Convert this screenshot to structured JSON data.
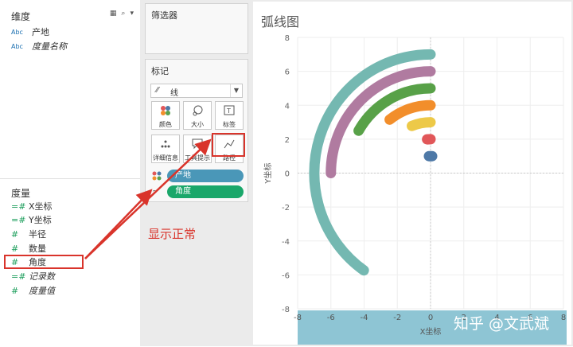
{
  "data_pane": {
    "dimensions_title": "维度",
    "dimensions": [
      {
        "type_icon": "Abc",
        "label": "产地",
        "italic": false
      },
      {
        "type_icon": "Abc",
        "label": "度量名称",
        "italic": true
      }
    ],
    "measures_title": "度量",
    "measures": [
      {
        "type_icon": "=#",
        "label": "X坐标",
        "italic": false
      },
      {
        "type_icon": "=#",
        "label": "Y坐标",
        "italic": false
      },
      {
        "type_icon": "#",
        "label": "半径",
        "italic": false
      },
      {
        "type_icon": "#",
        "label": "数量",
        "italic": false
      },
      {
        "type_icon": "#",
        "label": "角度",
        "italic": false
      },
      {
        "type_icon": "=#",
        "label": "记录数",
        "italic": true
      },
      {
        "type_icon": "#",
        "label": "度量值",
        "italic": true
      }
    ]
  },
  "filters_card": {
    "title": "筛选器"
  },
  "marks_card": {
    "title": "标记",
    "mark_type": "线",
    "buttons": [
      {
        "icon": "color-icon",
        "label": "颜色"
      },
      {
        "icon": "size-icon",
        "label": "大小"
      },
      {
        "icon": "label-icon",
        "label": "标签"
      },
      {
        "icon": "detail-icon",
        "label": "详细信息"
      },
      {
        "icon": "tooltip-icon",
        "label": "工具提示"
      },
      {
        "icon": "path-icon",
        "label": "路径"
      }
    ],
    "pills": [
      {
        "label": "产地",
        "color": "#4a97b8"
      },
      {
        "label": "角度",
        "color": "#1aa76a"
      }
    ]
  },
  "annotation": {
    "note": "显示正常"
  },
  "sheet": {
    "title": "弧线图",
    "watermark": "知乎 @文武斌"
  },
  "chart_data": {
    "type": "line",
    "x": {
      "label": "X坐标",
      "ticks": [
        -8,
        -6,
        -4,
        -2,
        0,
        2,
        4,
        6,
        8
      ],
      "range": [
        -8,
        8
      ]
    },
    "y": {
      "label": "Y坐标",
      "ticks": [
        8,
        6,
        4,
        2,
        0,
        -2,
        -4,
        -6,
        -8
      ],
      "range": [
        -8,
        8
      ]
    },
    "grid": true,
    "series": [
      {
        "radius": 7,
        "start_angle": 90,
        "end_angle": 235,
        "color": "#74b8b1"
      },
      {
        "radius": 6,
        "start_angle": 90,
        "end_angle": 180,
        "color": "#b07ba0"
      },
      {
        "radius": 5,
        "start_angle": 90,
        "end_angle": 150,
        "color": "#58a148"
      },
      {
        "radius": 4,
        "start_angle": 90,
        "end_angle": 128,
        "color": "#f28e2b"
      },
      {
        "radius": 3,
        "start_angle": 90,
        "end_angle": 112,
        "color": "#edc948"
      },
      {
        "radius": 2,
        "start_angle": 90,
        "end_angle": 96,
        "color": "#e15759"
      },
      {
        "radius": 1,
        "start_angle": 90,
        "end_angle": 91,
        "color": "#4e79a7"
      }
    ],
    "x_axis_band_color": "#8ec5d4"
  }
}
